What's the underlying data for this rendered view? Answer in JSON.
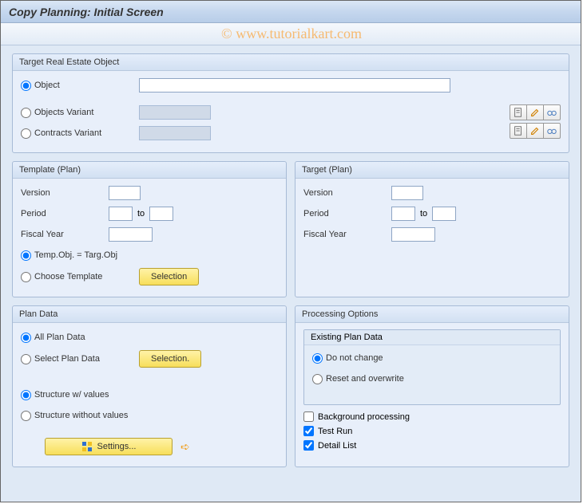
{
  "watermark": "© www.tutorialkart.com",
  "title": "Copy Planning: Initial Screen",
  "target_object": {
    "box_title": "Target Real Estate Object",
    "radio_object": "Object",
    "object_value": "",
    "radio_objects_variant": "Objects Variant",
    "objects_variant_value": "",
    "radio_contracts_variant": "Contracts Variant",
    "contracts_variant_value": ""
  },
  "template_plan": {
    "box_title": "Template (Plan)",
    "version_label": "Version",
    "version_value": "",
    "period_label": "Period",
    "period_from": "",
    "period_to_label": "to",
    "period_to": "",
    "fiscal_label": "Fiscal Year",
    "fiscal_value": "",
    "radio_same": "Temp.Obj. = Targ.Obj",
    "radio_choose": "Choose Template",
    "selection_btn": "Selection"
  },
  "target_plan": {
    "box_title": "Target (Plan)",
    "version_label": "Version",
    "version_value": "",
    "period_label": "Period",
    "period_from": "",
    "period_to_label": "to",
    "period_to": "",
    "fiscal_label": "Fiscal Year",
    "fiscal_value": ""
  },
  "plan_data": {
    "box_title": "Plan Data",
    "radio_all": "All Plan Data",
    "radio_select": "Select Plan Data",
    "selection_btn": "Selection.",
    "radio_struct_val": "Structure w/ values",
    "radio_struct_noval": "Structure without values",
    "settings_btn": "Settings..."
  },
  "processing": {
    "box_title": "Processing Options",
    "existing_title": "Existing Plan Data",
    "radio_nochange": "Do not change",
    "radio_reset": "Reset and overwrite",
    "check_bgproc": "Background processing",
    "check_testrun": "Test Run",
    "check_detail": "Detail List"
  }
}
